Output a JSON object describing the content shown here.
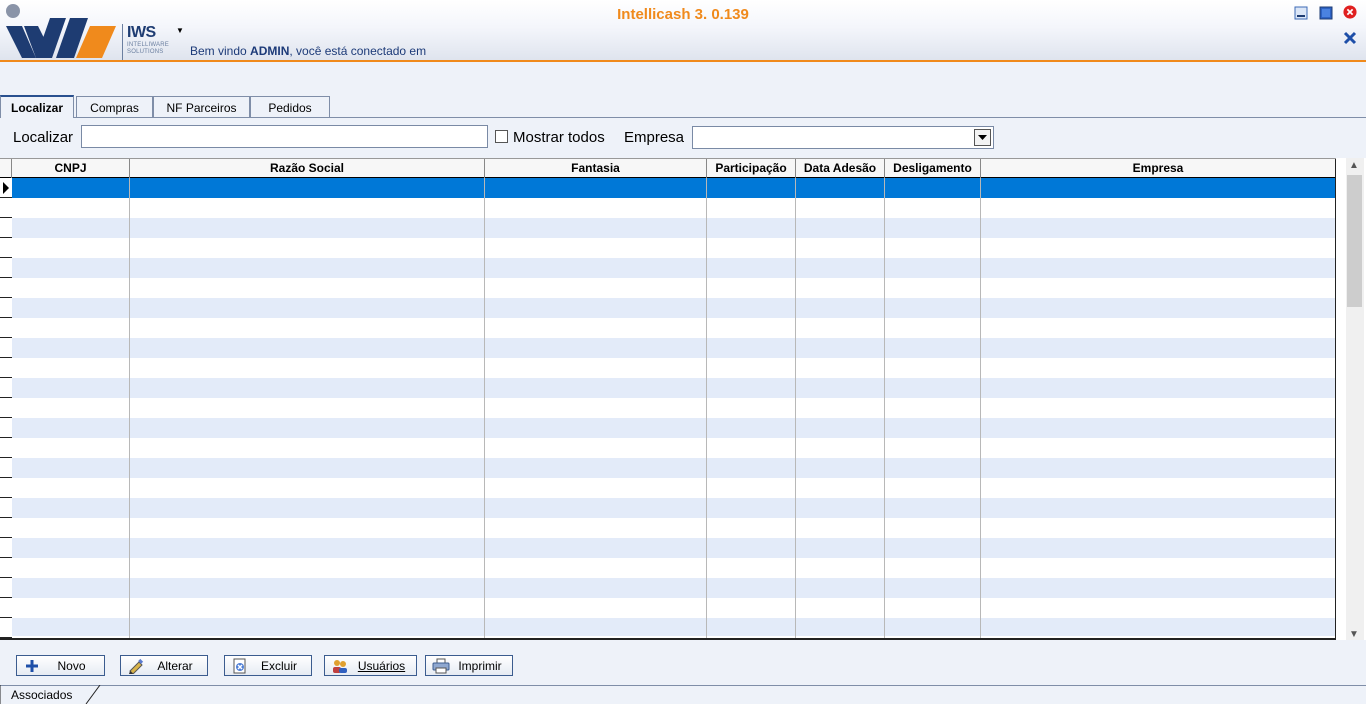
{
  "app": {
    "title": "Intellicash 3. 0.139",
    "brand_name": "IWS",
    "brand_sub_1": "INTELLIWARE",
    "brand_sub_2": "SOLUTIONS",
    "welcome_prefix": "Bem vindo ",
    "user": "ADMIN",
    "welcome_suffix": ", você está conectado em",
    "accent_color": "#f08a1c",
    "brand_color": "#1e3c72"
  },
  "tabs": [
    {
      "label": "Localizar",
      "active": true
    },
    {
      "label": "Compras",
      "active": false
    },
    {
      "label": "NF Parceiros",
      "active": false
    },
    {
      "label": "Pedidos",
      "active": false
    }
  ],
  "filter": {
    "search_label": "Localizar",
    "search_value": "",
    "show_all_label": "Mostrar todos",
    "show_all_checked": false,
    "company_label": "Empresa",
    "company_value": ""
  },
  "grid": {
    "columns": [
      "CNPJ",
      "Razão Social",
      "Fantasia",
      "Participação",
      "Data Adesão",
      "Desligamento",
      "Empresa"
    ],
    "rows": [],
    "selected_row_color": "#0078d7",
    "alt_row_color": "#e3ebf9"
  },
  "buttons": {
    "novo": "Novo",
    "alterar": "Alterar",
    "excluir": "Excluir",
    "usuarios": "Usuários",
    "imprimir": "Imprimir"
  },
  "footer": {
    "tab_label": "Associados"
  }
}
